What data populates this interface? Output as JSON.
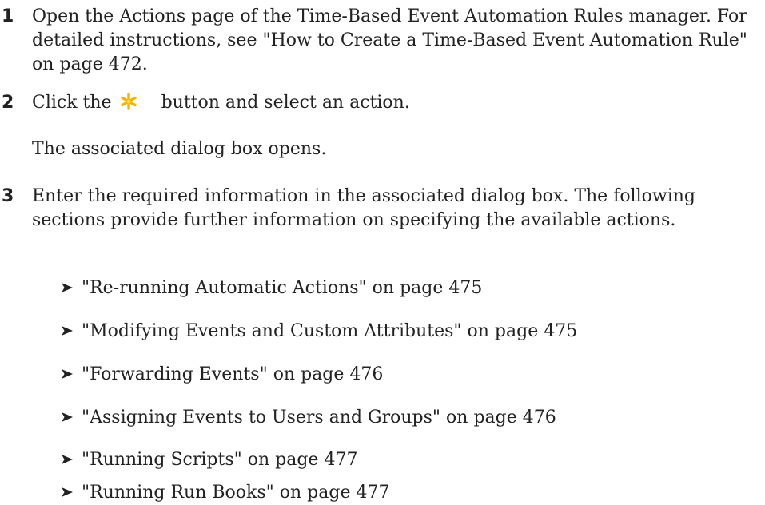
{
  "steps": [
    {
      "number": "1",
      "text": "Open the Actions page of the Time-Based Event Automation Rules manager. For detailed instructions, see \"How to Create a Time-Based Event Automation Rule\" on page 472."
    },
    {
      "number": "2",
      "text_before": "Click the",
      "icon": "asterisk-new-icon",
      "text_after": "button and select an action.",
      "note": "The associated dialog box opens."
    },
    {
      "number": "3",
      "text": "Enter the required information in the associated dialog box. The following sections provide further information on specifying the available actions."
    }
  ],
  "links": [
    "\"Re-running Automatic Actions\" on page 475",
    "\"Modifying Events and Custom Attributes\" on page 475",
    "\"Forwarding Events\" on page 476",
    "\"Assigning Events to Users and Groups\" on page 476",
    "\"Running Scripts\" on page 477",
    "\"Running Run Books\" on page 477"
  ],
  "colors": {
    "text": "#222222",
    "icon_star": "#F5B400",
    "bullet_arrow": "#222222"
  }
}
